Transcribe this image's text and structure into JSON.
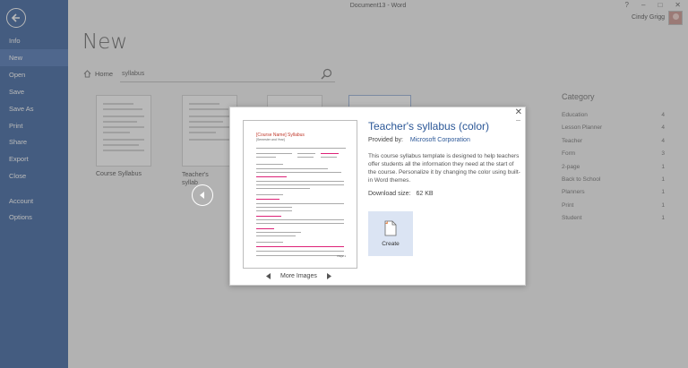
{
  "window": {
    "title": "Document13 - Word",
    "controls": [
      "?",
      "–",
      "□",
      "✕"
    ],
    "user_name": "Cindy Grigg"
  },
  "nav": {
    "items": [
      "Info",
      "New",
      "Open",
      "Save",
      "Save As",
      "Print",
      "Share",
      "Export",
      "Close",
      "Account",
      "Options"
    ],
    "active": "New"
  },
  "main": {
    "page_title": "New",
    "home_label": "Home",
    "search_value": "syllabus",
    "templates": [
      {
        "label": "Course Syllabus"
      },
      {
        "label": "Teacher's syllab"
      }
    ]
  },
  "category": {
    "title": "Category",
    "items": [
      {
        "name": "Education",
        "count": "4"
      },
      {
        "name": "Lesson Planner",
        "count": "4"
      },
      {
        "name": "Teacher",
        "count": "4"
      },
      {
        "name": "Form",
        "count": "3"
      },
      {
        "name": "2-page",
        "count": "1"
      },
      {
        "name": "Back to School",
        "count": "1"
      },
      {
        "name": "Planners",
        "count": "1"
      },
      {
        "name": "Print",
        "count": "1"
      },
      {
        "name": "Student",
        "count": "1"
      }
    ]
  },
  "dialog": {
    "title": "Teacher's syllabus (color)",
    "provided_label": "Provided by:",
    "provider": "Microsoft Corporation",
    "description": "This course syllabus template is designed to help teachers offer students all the information they need at the start of the course. Personalize it by changing the color using built-in Word themes.",
    "download_label": "Download size:",
    "download_size": "62 KB",
    "create_label": "Create",
    "more_images_label": "More Images",
    "thumb_title": "[Course Name] Syllabus",
    "thumb_subtitle": "[Semester and Year]",
    "thumb_page": "Page 1"
  },
  "colors": {
    "nav_bg": "#2b5797",
    "nav_active": "#3e6bb0",
    "accent": "#2b5797",
    "create_bg": "#dbe4f3"
  }
}
